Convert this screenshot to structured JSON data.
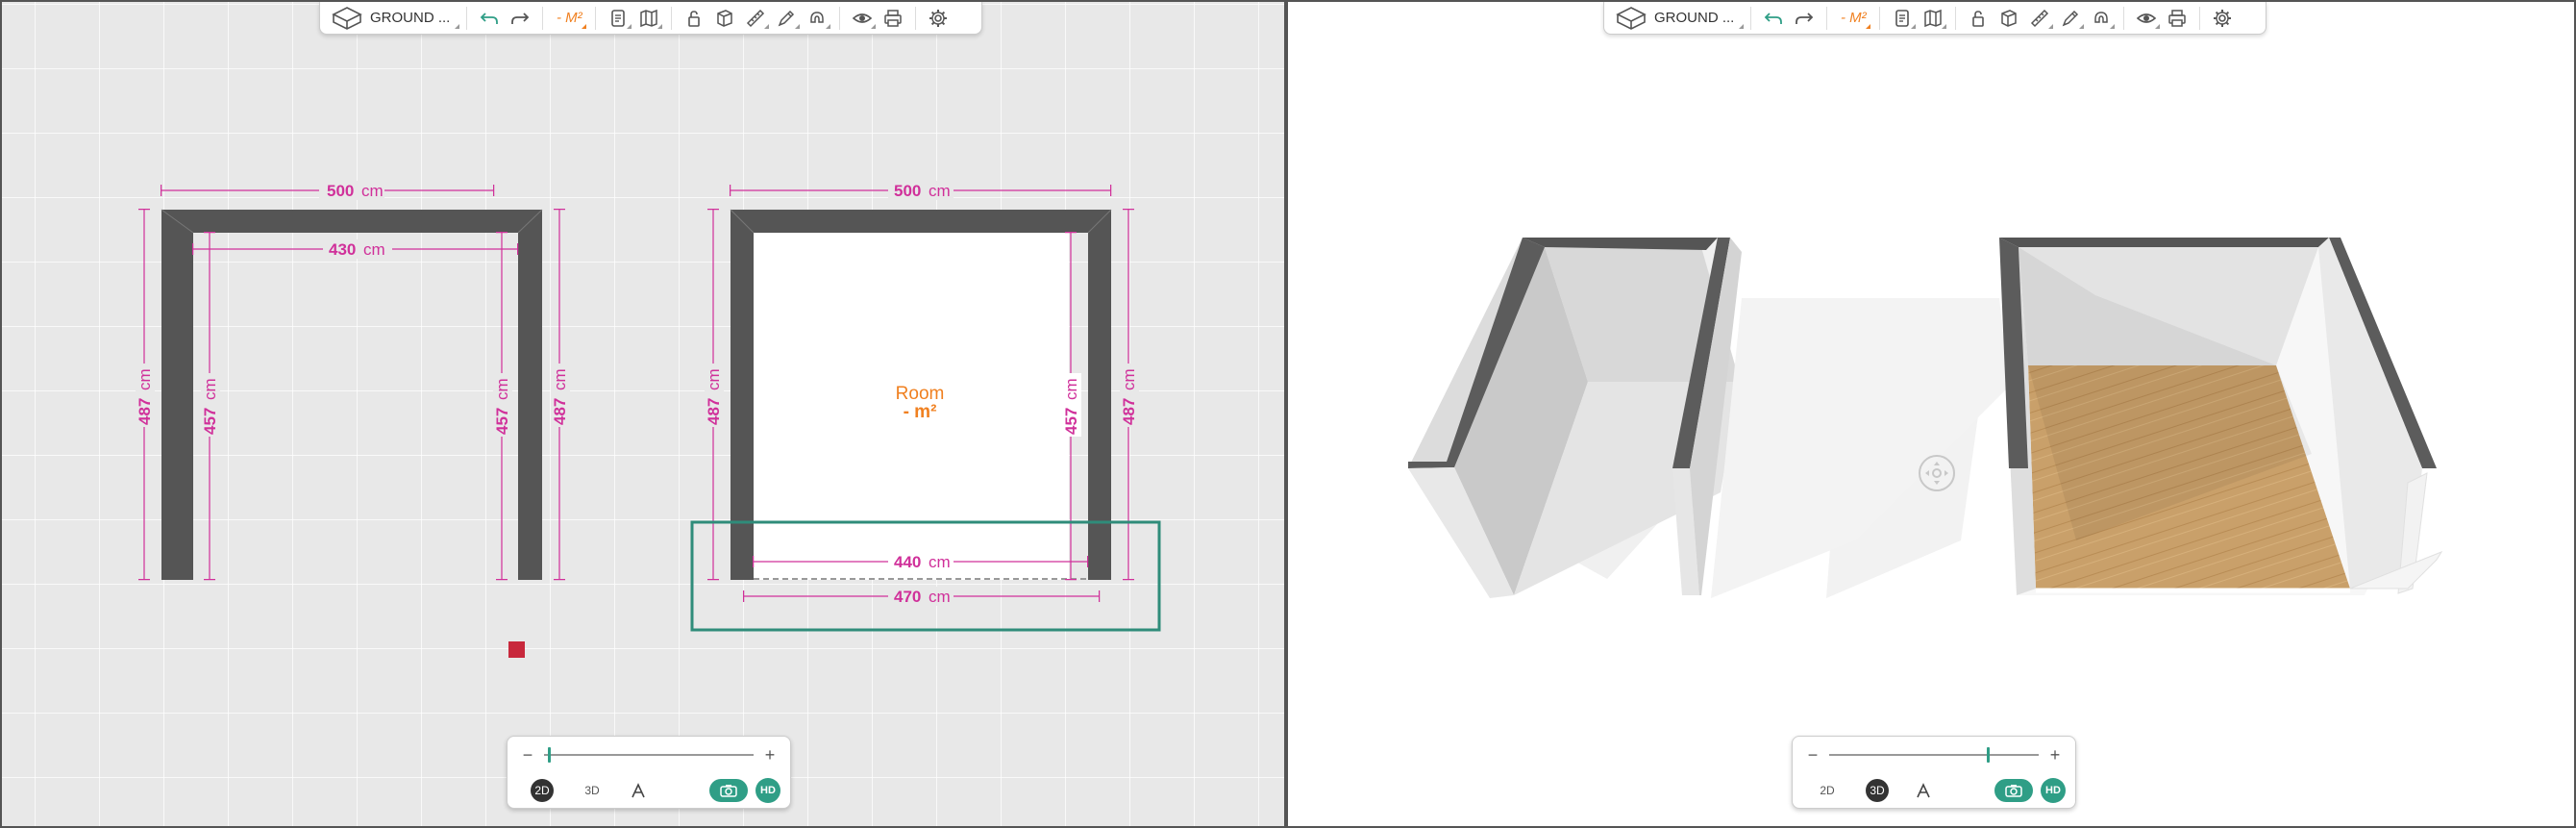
{
  "toolbar": {
    "level_label": "GROUND ...",
    "area_label": "- M²",
    "icons": [
      "level-cube-icon",
      "undo-icon",
      "redo-icon",
      "area-icon",
      "report-icon",
      "map-icon",
      "lock-icon",
      "wall-cube-icon",
      "ruler-icon",
      "pen-icon",
      "magnet-icon",
      "eye-icon",
      "print-icon",
      "gear-icon"
    ]
  },
  "plan": {
    "unit": "cm",
    "room1": {
      "top_outer": "500",
      "top_inner": "430",
      "left_outer": "487",
      "left_inner": "457",
      "right_inner": "457",
      "right_outer": "487"
    },
    "room2": {
      "top_outer": "500",
      "left_outer": "487",
      "right_inner": "457",
      "right_outer": "487",
      "bottom_inner": "440",
      "bottom_outer": "470",
      "room_name": "Room",
      "room_area": "- m²"
    }
  },
  "zoom_left": {
    "minus": "−",
    "plus": "+",
    "level": 0.02,
    "view_2d": "2D",
    "view_3d": "3D",
    "active": "2D",
    "hd": "HD"
  },
  "zoom_right": {
    "minus": "−",
    "plus": "+",
    "level": 0.75,
    "view_2d": "2D",
    "view_3d": "3D",
    "active": "3D",
    "hd": "HD"
  },
  "colors": {
    "accent": "#2f9e86",
    "dimension": "#d0309a",
    "wall": "#555555",
    "area": "#f08020",
    "selection": "#2f8c7a",
    "marker": "#c8283c"
  }
}
